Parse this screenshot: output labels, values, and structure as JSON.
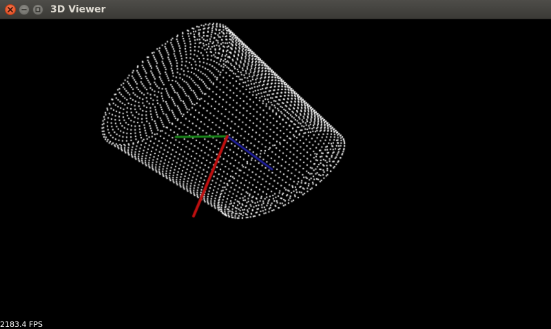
{
  "window": {
    "title": "3D Viewer"
  },
  "icons": {
    "close": "close-icon",
    "minimize": "minimize-icon",
    "maximize": "maximize-icon"
  },
  "status": {
    "fps": "2183.4 FPS"
  },
  "colors": {
    "background": "#000000",
    "points": "#ffffff",
    "axis_x": "#c01010",
    "axis_y": "#1a8a1a",
    "axis_z": "#1e1e9a"
  }
}
